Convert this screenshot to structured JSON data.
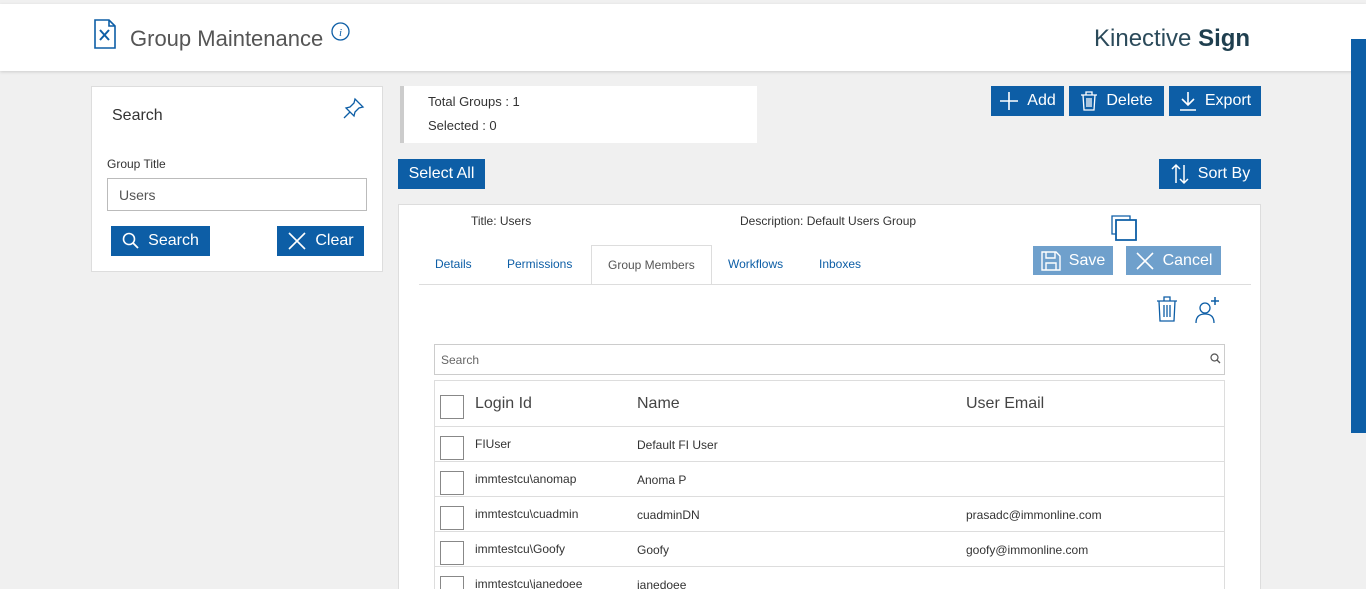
{
  "header": {
    "title": "Group Maintenance",
    "brand_light": "Kinective",
    "brand_bold": "Sign"
  },
  "colors": {
    "accent": "#0d5ea6",
    "accent_light": "#6fa0cc",
    "background": "#f0f0f0"
  },
  "search_panel": {
    "title": "Search",
    "field_label": "Group Title",
    "field_value": "Users",
    "search_label": "Search",
    "clear_label": "Clear"
  },
  "summary": {
    "total_groups": "Total Groups : 1",
    "selected": "Selected : 0"
  },
  "toolbar": {
    "add_label": "Add",
    "delete_label": "Delete",
    "export_label": "Export",
    "select_all_label": "Select All",
    "sort_by_label": "Sort By"
  },
  "group": {
    "title_text": "Title:  Users",
    "description_text": "Description: Default Users Group",
    "save_label": "Save",
    "cancel_label": "Cancel"
  },
  "tabs": [
    {
      "label": "Details"
    },
    {
      "label": "Permissions"
    },
    {
      "label": "Group Members"
    },
    {
      "label": "Workflows"
    },
    {
      "label": "Inboxes"
    }
  ],
  "members": {
    "search_placeholder": "Search",
    "columns": [
      "Login Id",
      "Name",
      "User Email"
    ],
    "rows": [
      {
        "login": "FIUser",
        "name": "Default FI User",
        "email": ""
      },
      {
        "login": "immtestcu\\anomap",
        "name": "Anoma P",
        "email": ""
      },
      {
        "login": "immtestcu\\cuadmin",
        "name": "cuadminDN",
        "email": "prasadc@immonline.com"
      },
      {
        "login": "immtestcu\\Goofy",
        "name": "Goofy",
        "email": "goofy@immonline.com"
      },
      {
        "login": "immtestcu\\janedoee",
        "name": "janedoee",
        "email": ""
      }
    ]
  }
}
